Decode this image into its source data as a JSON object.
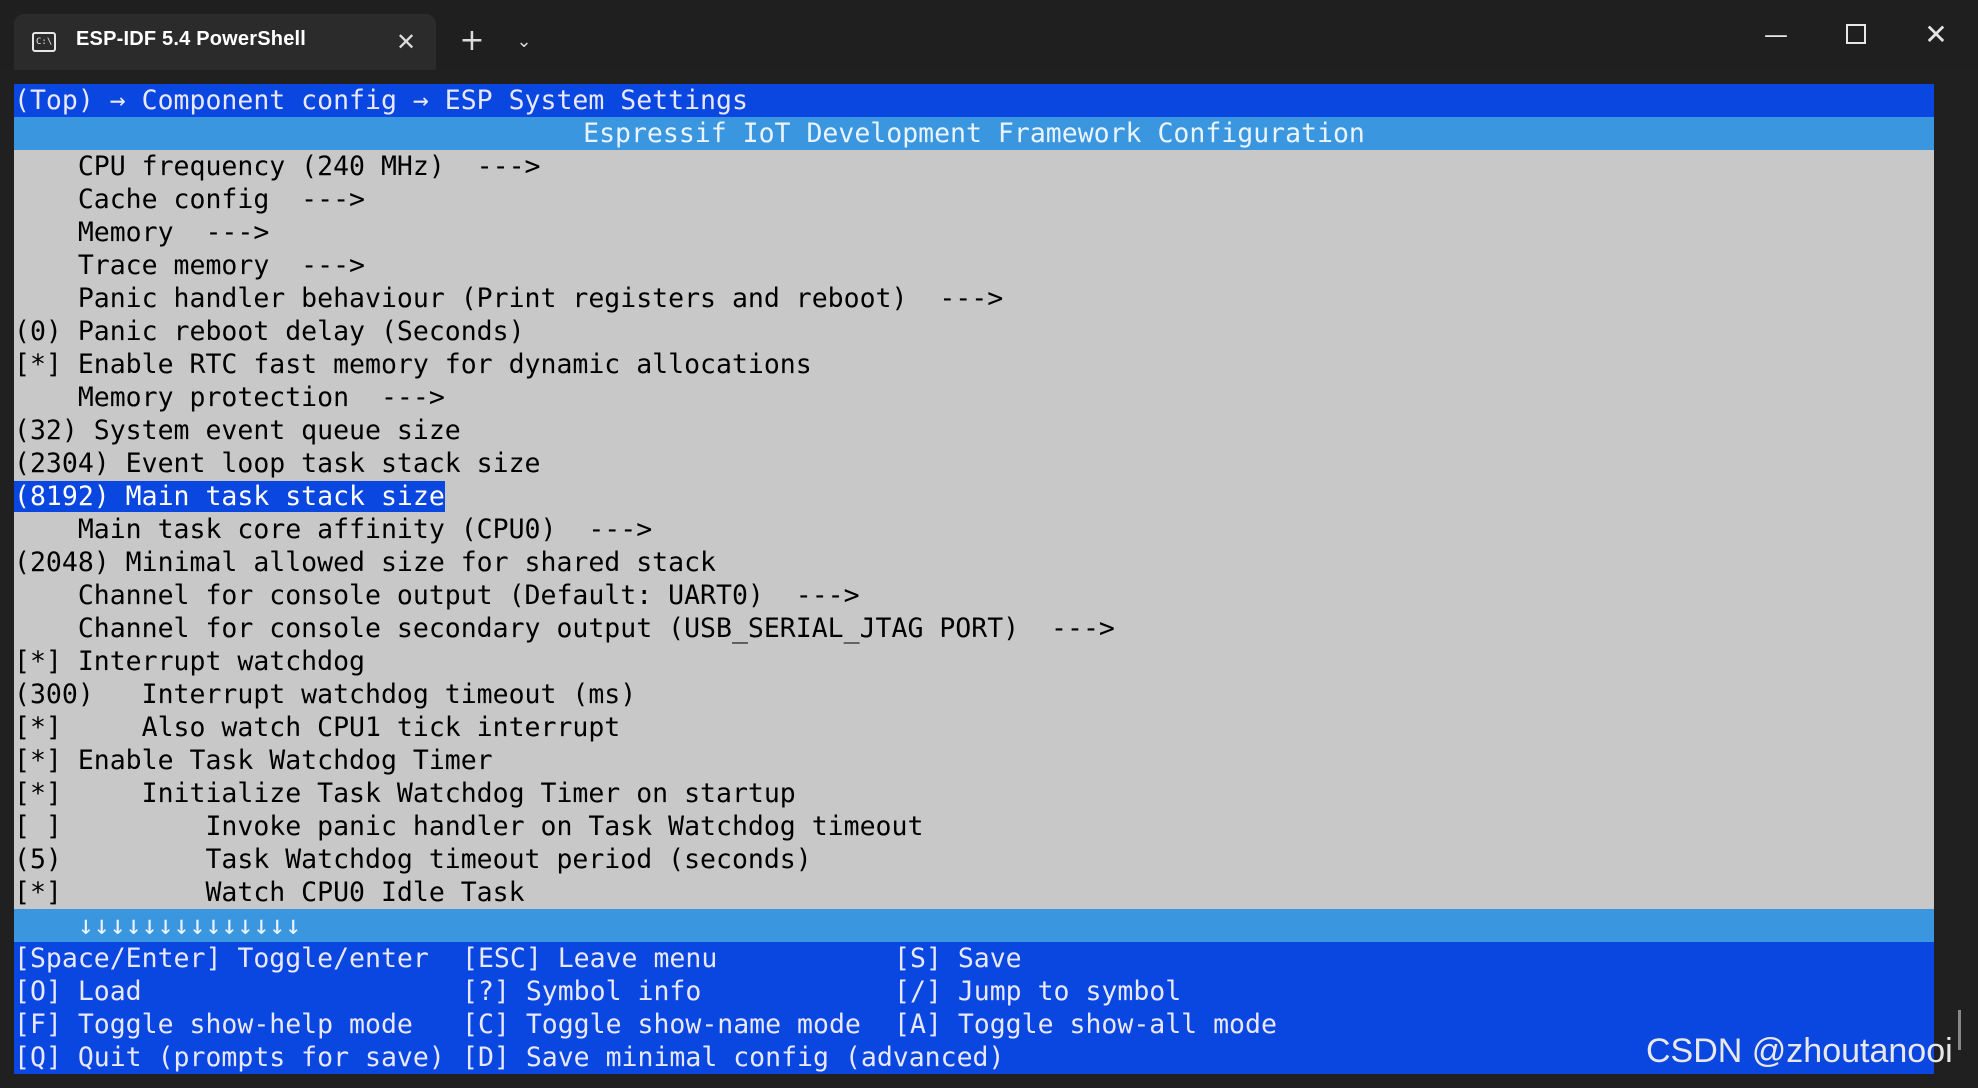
{
  "window": {
    "tab_icon": "C:\\",
    "tab_title": "ESP-IDF 5.4 PowerShell",
    "close_tab_glyph": "✕",
    "new_tab_glyph": "+",
    "dropdown_glyph": "⌄",
    "minimize_glyph": "—",
    "close_glyph": "✕"
  },
  "terminal": {
    "breadcrumb": "(Top) → Component config → ESP System Settings",
    "header": "Espressif IoT Development Framework Configuration",
    "lines": [
      "    CPU frequency (240 MHz)  --->",
      "    Cache config  --->",
      "    Memory  --->",
      "    Trace memory  --->",
      "    Panic handler behaviour (Print registers and reboot)  --->",
      "(0) Panic reboot delay (Seconds)",
      "[*] Enable RTC fast memory for dynamic allocations",
      "    Memory protection  --->",
      "(32) System event queue size",
      "(2304) Event loop task stack size",
      "(8192) Main task stack size",
      "    Main task core affinity (CPU0)  --->",
      "(2048) Minimal allowed size for shared stack",
      "    Channel for console output (Default: UART0)  --->",
      "    Channel for console secondary output (USB_SERIAL_JTAG PORT)  --->",
      "[*] Interrupt watchdog",
      "(300)   Interrupt watchdog timeout (ms)",
      "[*]     Also watch CPU1 tick interrupt",
      "[*] Enable Task Watchdog Timer",
      "[*]     Initialize Task Watchdog Timer on startup",
      "[ ]         Invoke panic handler on Task Watchdog timeout",
      "(5)         Task Watchdog timeout period (seconds)",
      "[*]         Watch CPU0 Idle Task"
    ],
    "selected_index": 10,
    "more_indicator": "    ↓↓↓↓↓↓↓↓↓↓↓↓↓↓",
    "help": [
      [
        "[Space/Enter] Toggle/enter",
        "[ESC] Leave menu",
        "[S] Save"
      ],
      [
        "[O] Load",
        "[?] Symbol info",
        "[/] Jump to symbol"
      ],
      [
        "[F] Toggle show-help mode",
        "[C] Toggle show-name mode",
        "[A] Toggle show-all mode"
      ],
      [
        "[Q] Quit (prompts for save)",
        "[D] Save minimal config (advanced)",
        ""
      ]
    ]
  },
  "watermark": "CSDN @zhoutanooi",
  "colors": {
    "terminal_bg": "#c8c8c8",
    "accent_blue": "#0a46e0",
    "header_cyan": "#3b96e0"
  }
}
